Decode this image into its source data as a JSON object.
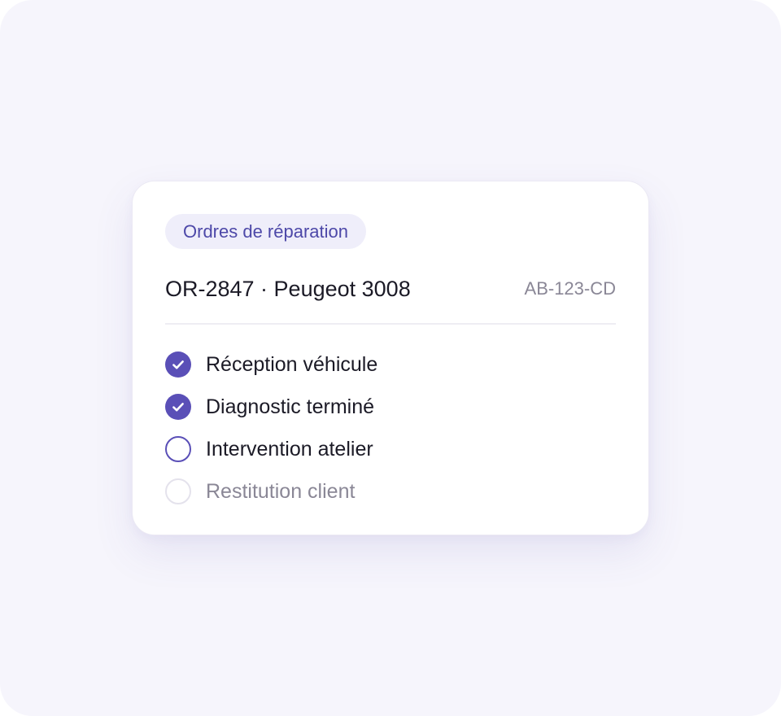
{
  "card": {
    "chip": "Ordres de réparation",
    "title": "OR-2847 · Peugeot 3008",
    "plate": "AB-123-CD"
  },
  "steps": [
    {
      "label": "Réception véhicule",
      "status": "done"
    },
    {
      "label": "Diagnostic terminé",
      "status": "done"
    },
    {
      "label": "Intervention atelier",
      "status": "current"
    },
    {
      "label": "Restitution client",
      "status": "pending"
    }
  ],
  "colors": {
    "accent": "#5a4fb7",
    "chip_background": "#efeefa",
    "chip_text": "#4d48a8",
    "text": "#1b1a26",
    "muted_text": "#8a8796",
    "pending_ring": "#e4e2ec",
    "page_background": "#f6f5fc"
  },
  "icons": {
    "done": "check-circle-icon",
    "current": "circle-outline-icon",
    "pending": "circle-outline-icon"
  }
}
